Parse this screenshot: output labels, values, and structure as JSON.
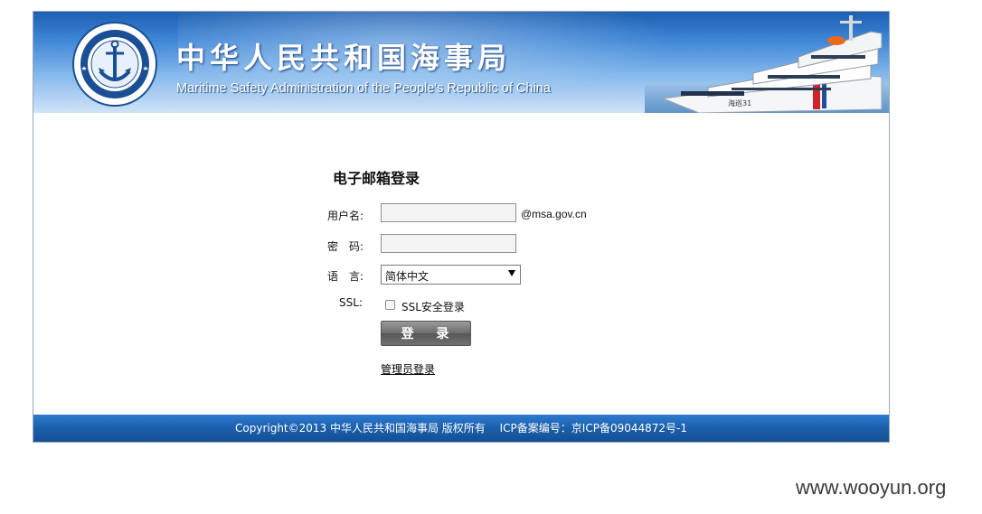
{
  "header": {
    "title_cn": "中华人民共和国海事局",
    "title_en": "Maritime Safety Administration of the People's Republic of China",
    "logo_text_top": "中国海事局",
    "logo_text_bottom": "CHINA MSA"
  },
  "login": {
    "title": "电子邮箱登录",
    "username_label": "用户名:",
    "username_value": "",
    "email_suffix": "@msa.gov.cn",
    "password_label": "密　码:",
    "password_value": "",
    "language_label": "语　言:",
    "language_selected": "简体中文",
    "ssl_label": "SSL:",
    "ssl_checkbox_label": "SSL安全登录",
    "ssl_checked": false,
    "login_button": "登 录",
    "admin_link": "管理员登录"
  },
  "footer": {
    "copyright": "Copyright©2013 中华人民共和国海事局 版权所有",
    "icp": "ICP备案编号：京ICP备09044872号-1"
  },
  "watermark": "www.wooyun.org",
  "colors": {
    "banner_top": "#1c5fb0",
    "footer": "#1b5fab",
    "button": "#6c6c6c"
  }
}
